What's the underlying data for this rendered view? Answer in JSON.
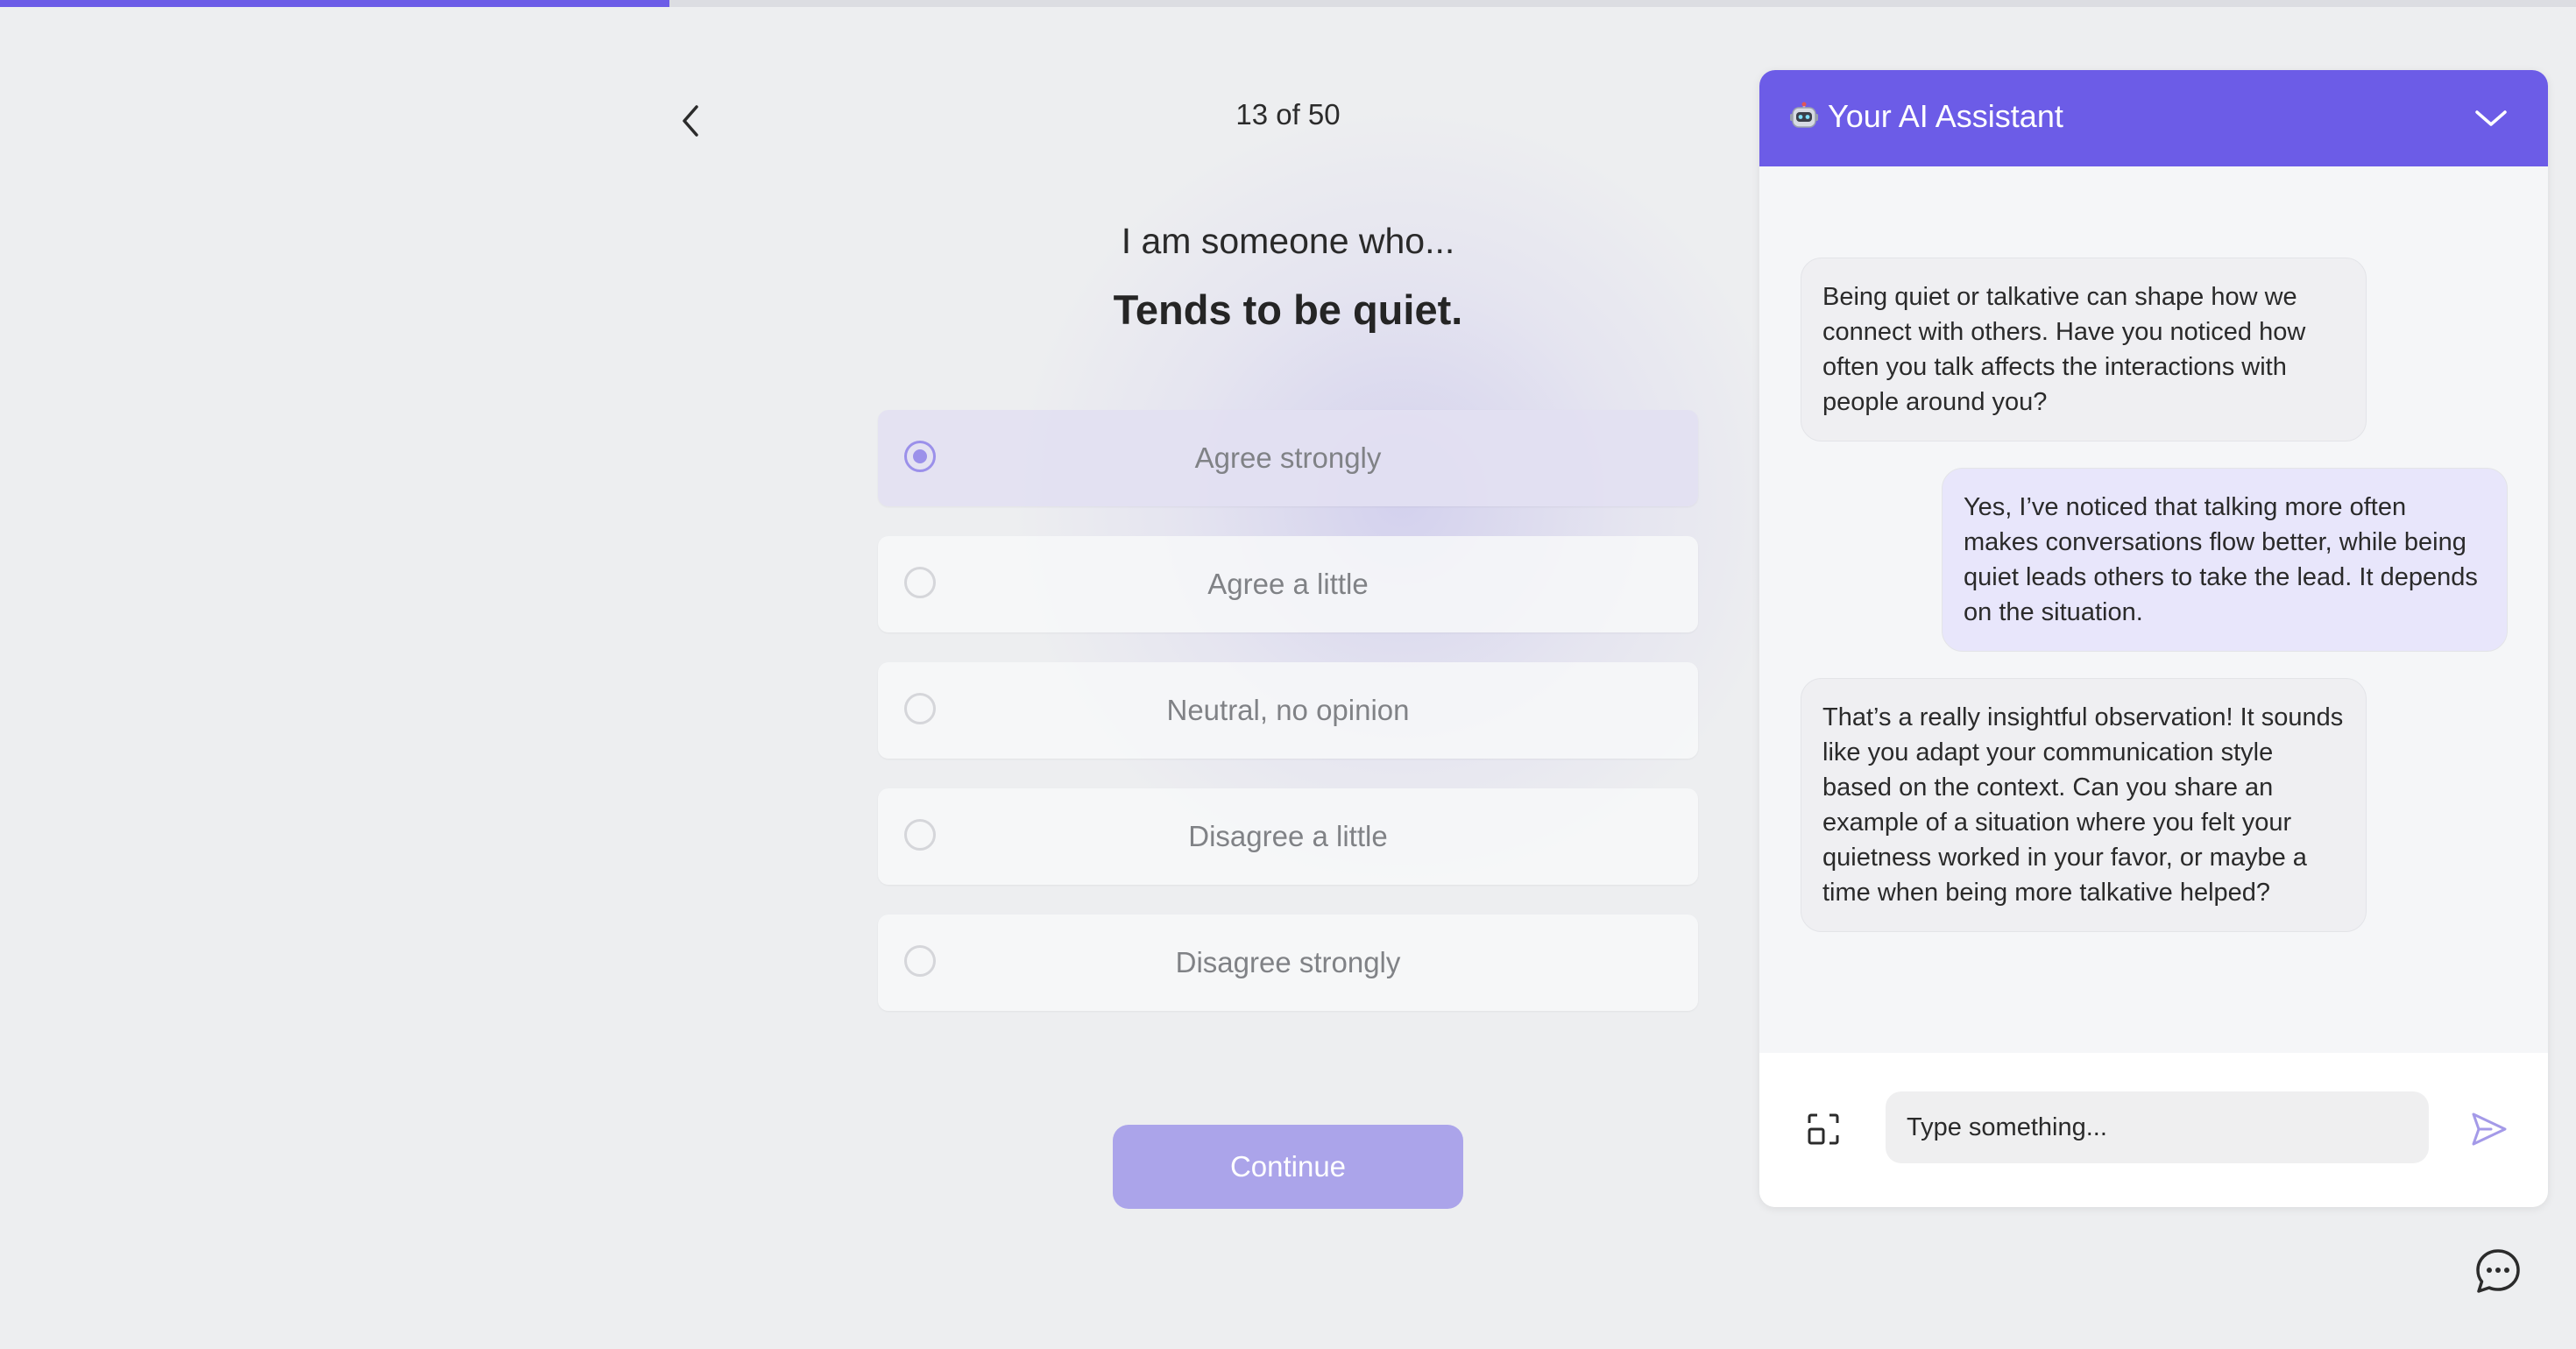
{
  "progress": {
    "fraction": 0.26,
    "fill_color": "#6c5ce7"
  },
  "quiz": {
    "counter": "13 of 50",
    "prompt": "I am someone who...",
    "question": "Tends to be quiet.",
    "options": [
      {
        "label": "Agree strongly",
        "selected": true
      },
      {
        "label": "Agree a little",
        "selected": false
      },
      {
        "label": "Neutral, no opinion",
        "selected": false
      },
      {
        "label": "Disagree a little",
        "selected": false
      },
      {
        "label": "Disagree strongly",
        "selected": false
      }
    ],
    "continue_label": "Continue",
    "back_icon": "chevron-left-icon"
  },
  "assistant": {
    "title": "Your AI Assistant",
    "title_icon": "robot-icon",
    "collapse_icon": "chevron-down-icon",
    "accent_color": "#6c5ce7",
    "messages": [
      {
        "role": "assistant",
        "text": "Being quiet or talkative can shape how we connect with others. Have you noticed how often you talk affects the interactions with people around you?"
      },
      {
        "role": "user",
        "text": "Yes, I’ve noticed that talking more often makes conversations flow better, while being quiet leads others to take the lead. It depends on the situation."
      },
      {
        "role": "assistant",
        "text": "That’s a really insightful observation! It sounds like you adapt your communication style based on the context. Can you share an example of a situation where you felt your quietness worked in your favor, or maybe a time when being more talkative helped?"
      }
    ],
    "input_placeholder": "Type something...",
    "attach_icon": "screenshot-capture-icon",
    "send_icon": "send-icon",
    "launcher_icon": "chat-bubble-icon"
  }
}
